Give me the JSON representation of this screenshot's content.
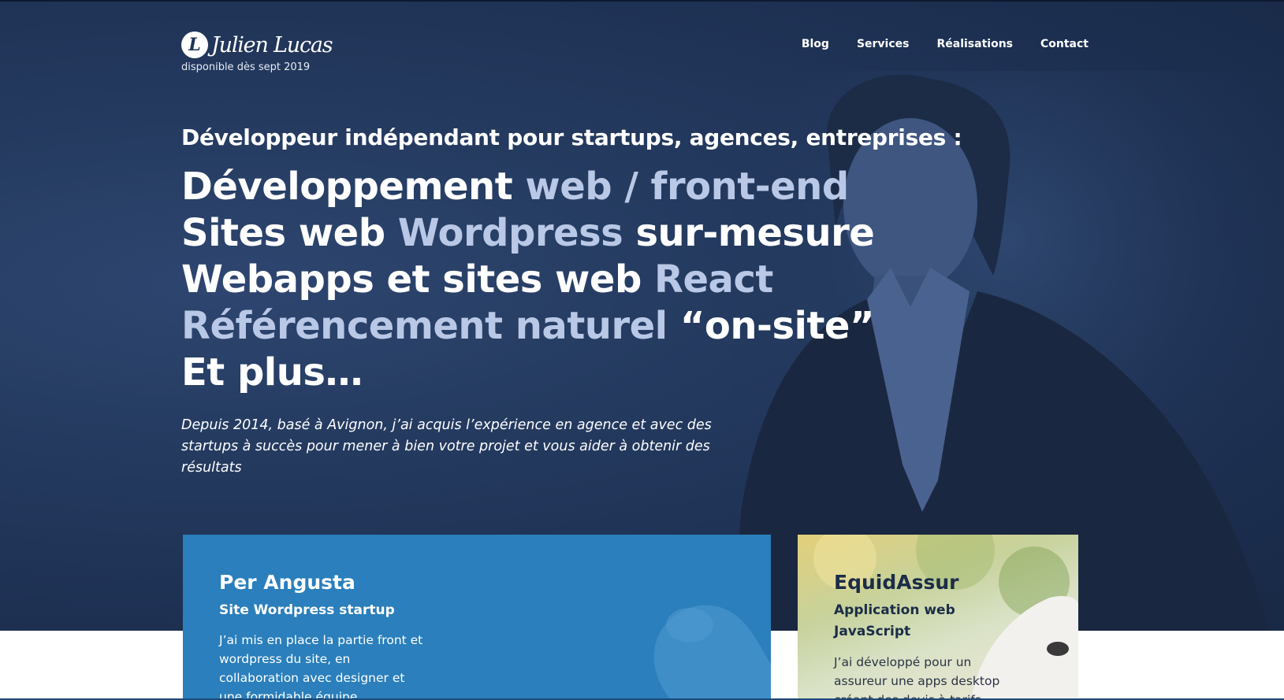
{
  "header": {
    "logo_mark": "L",
    "logo_name": "Julien Lucas",
    "availability": "disponible dès sept 2019"
  },
  "nav": {
    "items": [
      "Blog",
      "Services",
      "Réalisations",
      "Contact"
    ]
  },
  "hero": {
    "kicker": "Développeur indépendant pour startups, agences, entreprises :",
    "line1": {
      "a": "Développement ",
      "b": "web / front-end"
    },
    "line2": {
      "a": "Sites web ",
      "b": "Wordpress",
      "c": " sur-mesure"
    },
    "line3": {
      "a": "Webapps et sites web ",
      "b": "React"
    },
    "line4": {
      "a": "Référencement naturel",
      "b": " “on-site”"
    },
    "line5": {
      "a": "Et plus…"
    },
    "intro": "Depuis 2014, basé à Avignon, j’ai acquis l’expérience en agence et avec des startups à succès pour mener à bien votre projet et vous aider à obtenir des résultats"
  },
  "cards": [
    {
      "title": "Per Angusta",
      "subtitle": "Site Wordpress startup",
      "text": "J’ai mis en place la partie front et wordpress du site, en collaboration avec designer et une formidable équipe"
    },
    {
      "title": "EquidAssur",
      "subtitle": "Application web JavaScript",
      "text": "J’ai développé pour un assureur une apps desktop créant des devis à tarifs"
    }
  ],
  "colors": {
    "hero_bg": "#243a5f",
    "highlight": "#b9c8e6",
    "card_blue": "#2a7fbc"
  }
}
